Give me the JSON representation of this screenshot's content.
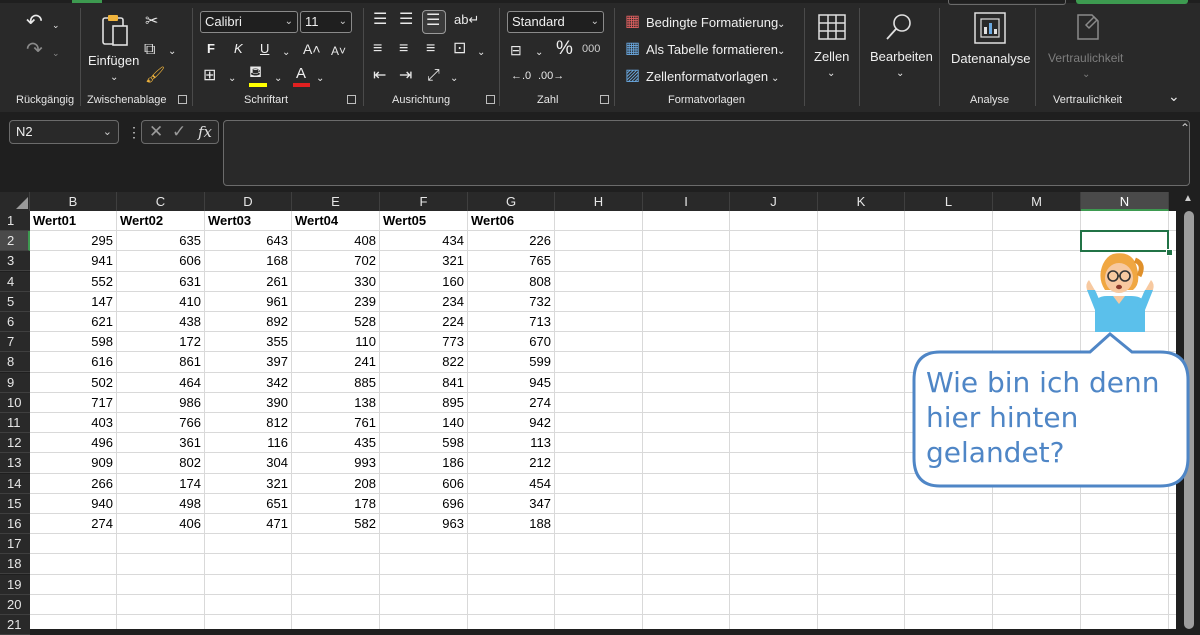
{
  "ribbon": {
    "groups": {
      "undo": "Rückgängig",
      "clipboard": "Zwischenablage",
      "font": "Schriftart",
      "alignment": "Ausrichtung",
      "number": "Zahl",
      "styles": "Formatvorlagen",
      "analysis": "Analyse",
      "sensitivity": "Vertraulichkeit"
    },
    "paste_label": "Einfügen",
    "font_name": "Calibri",
    "font_size": "11",
    "number_format": "Standard",
    "conditional_formatting": "Bedingte Formatierung",
    "format_as_table": "Als Tabelle formatieren",
    "cell_styles": "Zellenformatvorlagen",
    "cells": "Zellen",
    "editing": "Bearbeiten",
    "data_analysis": "Datenanalyse",
    "sensitivity_button": "Vertraulichkeit",
    "bold": "F",
    "italic": "K",
    "underline": "U",
    "font_color_letter": "A",
    "percent": "%",
    "thousands": "000"
  },
  "formula_bar": {
    "name_box": "N2",
    "fx": "fx",
    "formula": ""
  },
  "columns": [
    "B",
    "C",
    "D",
    "E",
    "F",
    "G",
    "H",
    "I",
    "J",
    "K",
    "L",
    "M",
    "N"
  ],
  "selected_column": "N",
  "selected_cell": "N2",
  "rows": [
    "1",
    "2",
    "3",
    "4",
    "5",
    "6",
    "7",
    "8",
    "9",
    "10",
    "11",
    "12",
    "13",
    "14",
    "15",
    "16",
    "17",
    "18",
    "19",
    "20",
    "21"
  ],
  "selected_row": "2",
  "table": {
    "headers": [
      "Wert01",
      "Wert02",
      "Wert03",
      "Wert04",
      "Wert05",
      "Wert06"
    ],
    "values": [
      [
        295,
        635,
        643,
        408,
        434,
        226
      ],
      [
        941,
        606,
        168,
        702,
        321,
        765
      ],
      [
        552,
        631,
        261,
        330,
        160,
        808
      ],
      [
        147,
        410,
        961,
        239,
        234,
        732
      ],
      [
        621,
        438,
        892,
        528,
        224,
        713
      ],
      [
        598,
        172,
        355,
        110,
        773,
        670
      ],
      [
        616,
        861,
        397,
        241,
        822,
        599
      ],
      [
        502,
        464,
        342,
        885,
        841,
        945
      ],
      [
        717,
        986,
        390,
        138,
        895,
        274
      ],
      [
        403,
        766,
        812,
        761,
        140,
        942
      ],
      [
        496,
        361,
        116,
        435,
        598,
        113
      ],
      [
        909,
        802,
        304,
        993,
        186,
        212
      ],
      [
        266,
        174,
        321,
        208,
        606,
        454
      ],
      [
        940,
        498,
        651,
        178,
        696,
        347
      ],
      [
        274,
        406,
        471,
        582,
        963,
        188
      ]
    ]
  },
  "bubble": {
    "line1": "Wie bin ich denn",
    "line2": "hier hinten",
    "line3": "gelandet?"
  },
  "colors": {
    "accent_green": "#217346",
    "bubble_blue": "#4f86c6"
  }
}
